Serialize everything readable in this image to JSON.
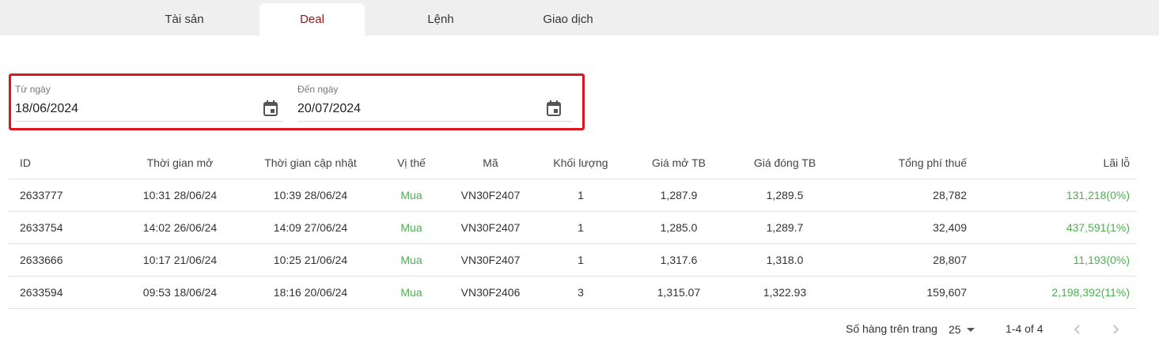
{
  "tabs": [
    {
      "label": "Tài sản"
    },
    {
      "label": "Deal"
    },
    {
      "label": "Lệnh"
    },
    {
      "label": "Giao dịch"
    }
  ],
  "active_tab": "Deal",
  "filters": {
    "from": {
      "label": "Từ ngày",
      "value": "18/06/2024"
    },
    "to": {
      "label": "Đến ngày",
      "value": "20/07/2024"
    }
  },
  "table": {
    "headers": {
      "id": "ID",
      "open_time": "Thời gian mở",
      "update_time": "Thời gian cập nhật",
      "position": "Vị thế",
      "symbol": "Mã",
      "volume": "Khối lượng",
      "avg_open": "Giá mở TB",
      "avg_close": "Giá đóng TB",
      "total_fee": "Tổng phí thuế",
      "pnl": "Lãi lỗ"
    },
    "rows": [
      {
        "id": "2633777",
        "open_time": "10:31 28/06/24",
        "update_time": "10:39 28/06/24",
        "position": "Mua",
        "symbol": "VN30F2407",
        "volume": "1",
        "avg_open": "1,287.9",
        "avg_close": "1,289.5",
        "total_fee": "28,782",
        "pnl": "131,218(0%)"
      },
      {
        "id": "2633754",
        "open_time": "14:02 26/06/24",
        "update_time": "14:09 27/06/24",
        "position": "Mua",
        "symbol": "VN30F2407",
        "volume": "1",
        "avg_open": "1,285.0",
        "avg_close": "1,289.7",
        "total_fee": "32,409",
        "pnl": "437,591(1%)"
      },
      {
        "id": "2633666",
        "open_time": "10:17 21/06/24",
        "update_time": "10:25 21/06/24",
        "position": "Mua",
        "symbol": "VN30F2407",
        "volume": "1",
        "avg_open": "1,317.6",
        "avg_close": "1,318.0",
        "total_fee": "28,807",
        "pnl": "11,193(0%)"
      },
      {
        "id": "2633594",
        "open_time": "09:53 18/06/24",
        "update_time": "18:16 20/06/24",
        "position": "Mua",
        "symbol": "VN30F2406",
        "volume": "3",
        "avg_open": "1,315.07",
        "avg_close": "1,322.93",
        "total_fee": "159,607",
        "pnl": "2,198,392(11%)"
      }
    ]
  },
  "pagination": {
    "rows_per_page_label": "Số hàng trên trang",
    "rows_per_page": "25",
    "range": "1-4 of 4"
  },
  "icons": {
    "calendar": "calendar-icon",
    "dropdown": "arrow-drop-down-icon",
    "prev": "chevron-left-icon",
    "next": "chevron-right-icon"
  },
  "colors": {
    "active_tab_text": "#8b1a1a",
    "highlight_border": "#e0141e",
    "buy": "#4caf50",
    "profit": "#4caf50",
    "tab_bar_bg": "#efefef"
  }
}
